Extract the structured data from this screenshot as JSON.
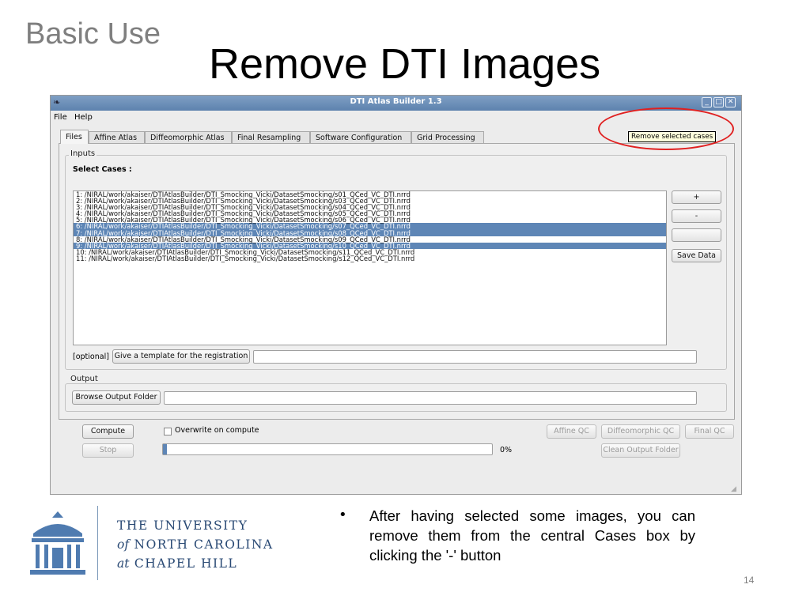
{
  "slide": {
    "section": "Basic Use",
    "title": "Remove DTI Images",
    "page_number": "14",
    "bullet": "After having selected some images, you can remove them from the central Cases box by clicking the '-' button"
  },
  "university": {
    "line1": "THE UNIVERSITY",
    "line2_prefix": "of",
    "line2": "NORTH CAROLINA",
    "line3_prefix": "at",
    "line3": "CHAPEL HILL"
  },
  "window": {
    "title": "DTI Atlas Builder 1.3",
    "menu": [
      "File",
      "Help"
    ],
    "tabs": [
      "Files",
      "Affine Atlas",
      "Diffeomorphic Atlas",
      "Final Resampling",
      "Software Configuration",
      "Grid Processing"
    ],
    "active_tab": "Files"
  },
  "inputs": {
    "group_label": "Inputs",
    "select_cases_label": "Select Cases :",
    "cases": [
      {
        "text": "1: /NIRAL/work/akaiser/DTIAtlasBuilder/DTI_Smocking_Vicki/DatasetSmocking/s01_QCed_VC_DTI.nrrd",
        "selected": false
      },
      {
        "text": "2: /NIRAL/work/akaiser/DTIAtlasBuilder/DTI_Smocking_Vicki/DatasetSmocking/s03_QCed_VC_DTI.nrrd",
        "selected": false
      },
      {
        "text": "3: /NIRAL/work/akaiser/DTIAtlasBuilder/DTI_Smocking_Vicki/DatasetSmocking/s04_QCed_VC_DTI.nrrd",
        "selected": false
      },
      {
        "text": "4: /NIRAL/work/akaiser/DTIAtlasBuilder/DTI_Smocking_Vicki/DatasetSmocking/s05_QCed_VC_DTI.nrrd",
        "selected": false
      },
      {
        "text": "5: /NIRAL/work/akaiser/DTIAtlasBuilder/DTI_Smocking_Vicki/DatasetSmocking/s06_QCed_VC_DTI.nrrd",
        "selected": false
      },
      {
        "text": "6: /NIRAL/work/akaiser/DTIAtlasBuilder/DTI_Smocking_Vicki/DatasetSmocking/s07_QCed_VC_DTI.nrrd",
        "selected": true
      },
      {
        "text": "7: /NIRAL/work/akaiser/DTIAtlasBuilder/DTI_Smocking_Vicki/DatasetSmocking/s08_QCed_VC_DTI.nrrd",
        "selected": true
      },
      {
        "text": "8: /NIRAL/work/akaiser/DTIAtlasBuilder/DTI_Smocking_Vicki/DatasetSmocking/s09_QCed_VC_DTI.nrrd",
        "selected": false
      },
      {
        "text": "9: /NIRAL/work/akaiser/DTIAtlasBuilder/DTI_Smocking_Vicki/DatasetSmocking/s10_QCed_VC_DTI.nrrd",
        "selected": true
      },
      {
        "text": "10: /NIRAL/work/akaiser/DTIAtlasBuilder/DTI_Smocking_Vicki/DatasetSmocking/s11_QCed_VC_DTI.nrrd",
        "selected": false
      },
      {
        "text": "11: /NIRAL/work/akaiser/DTIAtlasBuilder/DTI_Smocking_Vicki/DatasetSmocking/s12_QCed_VC_DTI.nrrd",
        "selected": false
      }
    ],
    "add_label": "+",
    "remove_label": "-",
    "save_label": "Save Data",
    "tooltip": "Remove selected cases",
    "optional_label": "[optional]",
    "template_button": "Give a template for the registration",
    "template_value": ""
  },
  "output": {
    "group_label": "Output",
    "browse_button": "Browse Output Folder",
    "folder_value": ""
  },
  "bottom": {
    "compute": "Compute",
    "stop": "Stop",
    "overwrite_label": "Overwrite on compute",
    "progress_percent": 0,
    "progress_text": "0%",
    "affine_qc": "Affine QC",
    "diffeo_qc": "Diffeomorphic QC",
    "final_qc": "Final QC",
    "clean_output": "Clean Output Folder"
  },
  "colors": {
    "selection": "#5e86b6",
    "annotation": "#e02020",
    "unc_blue": "#294974"
  }
}
